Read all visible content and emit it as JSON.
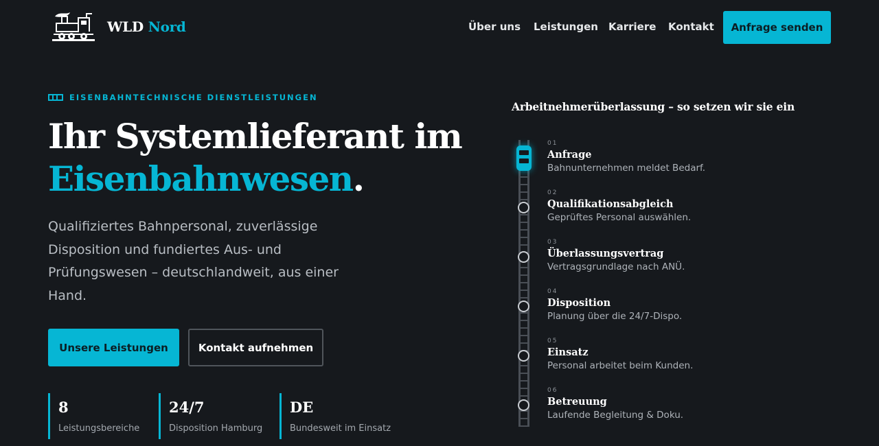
{
  "header": {
    "brand_main": "WLD",
    "brand_accent": "Nord",
    "nav": [
      "Über uns",
      "Leistungen",
      "Karriere",
      "Kontakt"
    ],
    "cta_label": "Anfrage senden"
  },
  "hero": {
    "eyebrow": "EISENBAHNTECHNISCHE DIENSTLEISTUNGEN",
    "title_line1": "Ihr Systemlieferant im",
    "title_accent": "Eisenbahnwesen",
    "title_end": ".",
    "lead": "Qualifiziertes Bahnpersonal, zuverlässige Disposition und fundiertes Aus- und Prüfungswesen – deutschlandweit, aus einer Hand.",
    "primary_button": "Unsere Leistungen",
    "secondary_button": "Kontakt aufnehmen",
    "stats": [
      {
        "value": "8",
        "label": "Leistungsbereiche"
      },
      {
        "value": "24/7",
        "label": "Disposition Hamburg"
      },
      {
        "value": "DE",
        "label": "Bundesweit im Einsatz"
      }
    ]
  },
  "process": {
    "title": "Arbeitnehmerüberlassung – so setzen wir sie ein",
    "steps": [
      {
        "num": "01",
        "title": "Anfrage",
        "desc": "Bahnunternehmen meldet Bedarf."
      },
      {
        "num": "02",
        "title": "Qualifikationsabgleich",
        "desc": "Geprüftes Personal auswählen."
      },
      {
        "num": "03",
        "title": "Überlassungsvertrag",
        "desc": "Vertragsgrundlage nach ANÜ."
      },
      {
        "num": "04",
        "title": "Disposition",
        "desc": "Planung über die 24/7-Dispo."
      },
      {
        "num": "05",
        "title": "Einsatz",
        "desc": "Personal arbeitet beim Kunden."
      },
      {
        "num": "06",
        "title": "Betreuung",
        "desc": "Laufende Begleitung & Doku."
      }
    ]
  },
  "colors": {
    "accent": "#06b6d4",
    "background": "#16191d"
  },
  "icons": {
    "logo": "steam-locomotive-icon",
    "eyebrow": "rail-track-icon",
    "timeline_marker": "train-icon"
  }
}
